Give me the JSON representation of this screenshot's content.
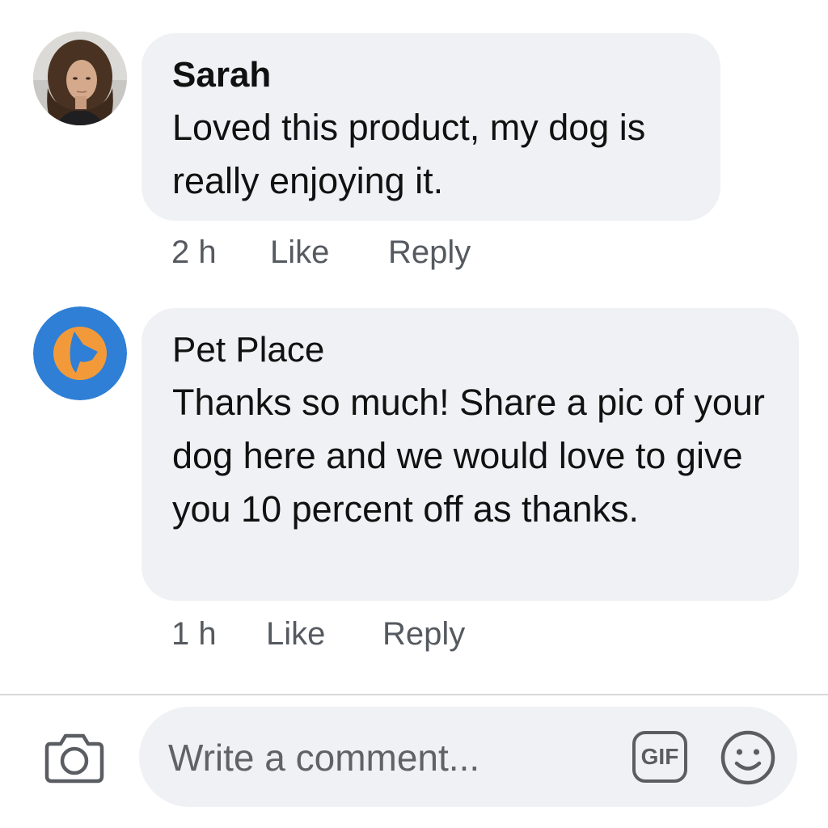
{
  "comments": [
    {
      "author": "Sarah",
      "text": "Loved this product, my dog is really enjoying it.",
      "time": "2 h",
      "like_label": "Like",
      "reply_label": "Reply",
      "avatar_icon": "user-photo-avatar"
    },
    {
      "author": "Pet Place",
      "text": "Thanks so much! Share a pic of your dog here and we would love to give you 10 percent off as thanks.",
      "time": "1 h",
      "like_label": "Like",
      "reply_label": "Reply",
      "avatar_icon": "pet-place-logo"
    }
  ],
  "composer": {
    "placeholder": "Write a comment...",
    "gif_label": "GIF",
    "camera_icon": "camera-icon",
    "emoji_icon": "smiley-icon"
  },
  "colors": {
    "bubble_background": "#f0f1f4",
    "meta_text": "#555a60",
    "brand_blue": "#2f7fd6",
    "brand_orange": "#f29a3a",
    "icon_gray": "#5a5d62"
  }
}
